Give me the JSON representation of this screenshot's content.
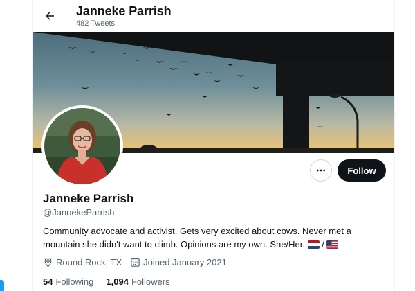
{
  "header": {
    "name": "Janneke Parrish",
    "tweet_count": "482 Tweets"
  },
  "profile": {
    "display_name": "Janneke Parrish",
    "handle": "@JannekeParrish",
    "bio_text": "Community advocate and activist. Gets very excited about cows. Never met a mountain she didn't want to climb. Opinions are my own. She/Her.",
    "bio_separator": "/",
    "bio_flags": [
      "flag-netherlands-icon",
      "flag-united-states-icon"
    ],
    "location": "Round Rock, TX",
    "joined": "Joined January 2021"
  },
  "actions": {
    "more_icon": "more-icon",
    "follow_label": "Follow"
  },
  "stats": {
    "following_count": "54",
    "following_label": "Following",
    "followers_count": "1,094",
    "followers_label": "Followers"
  },
  "colors": {
    "follow_button_bg": "#0f1419",
    "secondary_text": "#536471",
    "accent": "#1d9bf0"
  }
}
